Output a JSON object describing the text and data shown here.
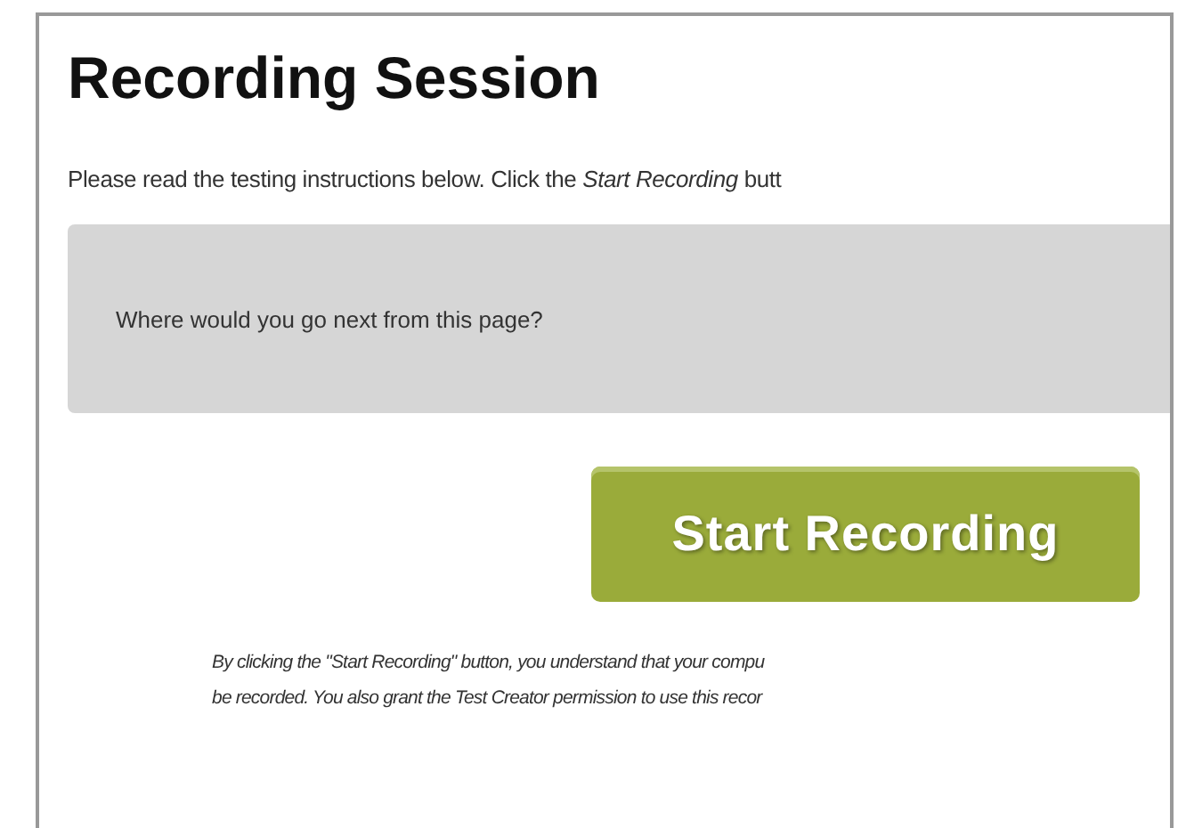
{
  "heading": "Recording Session",
  "instructions": "Please read the testing instructions below. Click the *Start Recording* butt",
  "task_box": {
    "question": "Where would you go next from this page?"
  },
  "start_button": {
    "label": "Start Recording"
  },
  "disclaimer_lines": [
    "By clicking the \"Start Recording\" button, you understand that your compu",
    "be recorded. You also grant the Test Creator permission to use this recor"
  ]
}
